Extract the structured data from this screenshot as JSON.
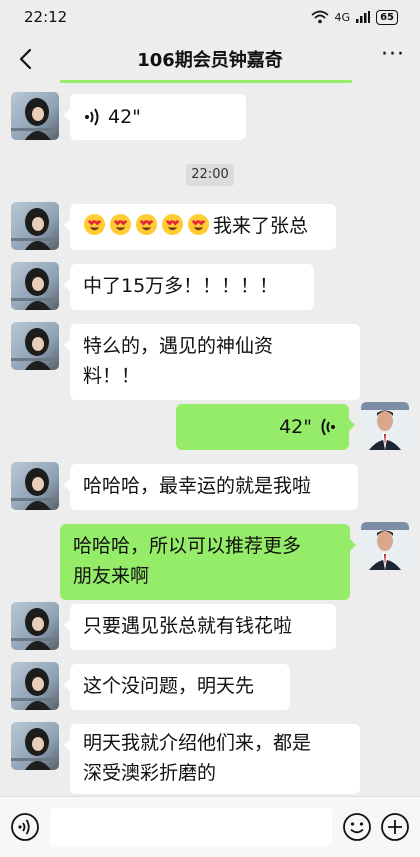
{
  "status": {
    "time": "22:12",
    "network": "4G",
    "battery": "65"
  },
  "header": {
    "title": "106期会员钟嘉奇"
  },
  "messages": [
    {
      "side": "left",
      "type": "voice",
      "duration": "42\""
    },
    {
      "type": "time",
      "text": "22:00"
    },
    {
      "side": "left",
      "type": "text",
      "emoji_count": 5,
      "text": "我来了张总"
    },
    {
      "side": "left",
      "type": "text",
      "text": "中了15万多！！！！！"
    },
    {
      "side": "left",
      "type": "text",
      "line1": "特么的，遇见的神仙资",
      "line2": "料！！"
    },
    {
      "side": "right",
      "type": "voice",
      "duration": "42\""
    },
    {
      "side": "left",
      "type": "text",
      "text": "哈哈哈，最幸运的就是我啦"
    },
    {
      "side": "right",
      "type": "text",
      "line1": "哈哈哈，所以可以推荐更多",
      "line2": "朋友来啊"
    },
    {
      "side": "left",
      "type": "text",
      "text": "只要遇见张总就有钱花啦"
    },
    {
      "side": "left",
      "type": "text",
      "text": "这个没问题，明天先"
    },
    {
      "side": "left",
      "type": "text",
      "line1": "明天我就介绍他们来，都是",
      "line2": "深受澳彩折磨的"
    }
  ],
  "icons": {
    "back": "chevron-left-icon",
    "more": "more-icon",
    "voice_input": "voice-icon",
    "emoji": "emoji-icon",
    "plus": "plus-icon"
  },
  "colors": {
    "bubble_mine": "#95ec69",
    "bubble_other": "#ffffff",
    "background": "#ededed"
  }
}
